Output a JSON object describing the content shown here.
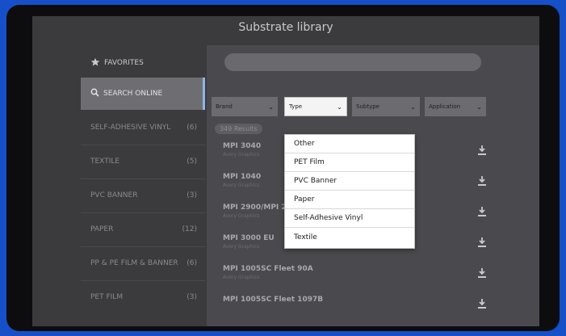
{
  "header": {
    "title": "Substrate library"
  },
  "sidebar": {
    "favorites": "FAVORITES",
    "search_online": "SEARCH ONLINE",
    "items": [
      {
        "label": "SELF-ADHESIVE VINYL",
        "count": "(6)"
      },
      {
        "label": "TEXTILE",
        "count": "(5)"
      },
      {
        "label": "PVC BANNER",
        "count": "(3)"
      },
      {
        "label": "PAPER",
        "count": "(12)"
      },
      {
        "label": "PP & PE FILM & BANNER",
        "count": "(6)"
      },
      {
        "label": "PET FILM",
        "count": "(3)"
      }
    ]
  },
  "search": {
    "placeholder": ""
  },
  "filters": {
    "brand": "Brand",
    "type": "Type",
    "subtype": "Subtype",
    "application": "Application"
  },
  "results": {
    "count_label": "349 Results",
    "rows": [
      {
        "title": "MPI 3040",
        "subtitle": "Avery Graphics"
      },
      {
        "title": "MPI 1040",
        "subtitle": "Avery Graphics"
      },
      {
        "title": "MPI 2900/MPI 2",
        "subtitle": "Avery Graphics"
      },
      {
        "title": "MPI 3000 EU",
        "subtitle": "Avery Graphics"
      },
      {
        "title": "MPI 1005SC Fleet 90A",
        "subtitle": "Avery Graphics"
      },
      {
        "title": "MPI 1005SC Fleet 1097B",
        "subtitle": ""
      }
    ]
  },
  "type_dropdown": {
    "options": [
      "Other",
      "PET Film",
      "PVC Banner",
      "Paper",
      "Self-Adhesive Vinyl",
      "Textile"
    ]
  },
  "icons": {
    "home": "home-icon",
    "back": "back-icon",
    "help": "help-icon",
    "download": "download-icon",
    "star": "star-icon",
    "search": "search-icon"
  },
  "colors": {
    "bezel_accent": "#1650c8",
    "selected_highlight": "#8fb4e8"
  }
}
